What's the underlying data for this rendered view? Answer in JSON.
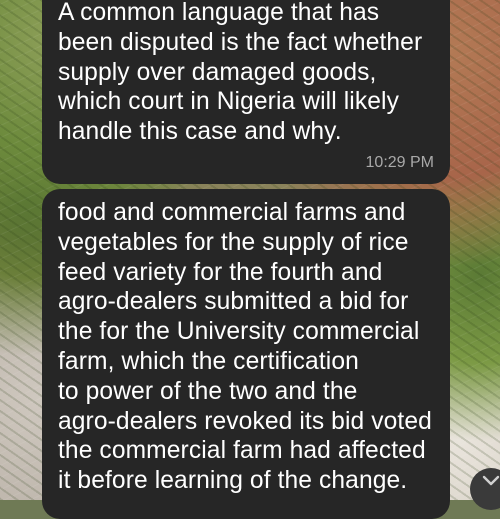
{
  "messages": [
    {
      "text": "A common language that has\nbeen disputed is the fact whether\nsupply over damaged goods,\nwhich court in Nigeria will likely\nhandle this case and why.",
      "time": "10:29 PM"
    },
    {
      "text": "food and commercial farms and\nvegetables for the supply of rice\nfeed variety for the fourth and\nagro-dealers submitted a bid for\nthe for the University commercial\nfarm, which the certification\nto power of the two and the\nagro-dealers revoked its bid voted\nthe commercial farm had affected\nit before learning of the change."
    }
  ],
  "scroll_button": {
    "icon": "chevron-down-icon"
  },
  "colors": {
    "bubble": "#262626",
    "text": "#ffffff",
    "timestamp": "#a9a9a9"
  }
}
